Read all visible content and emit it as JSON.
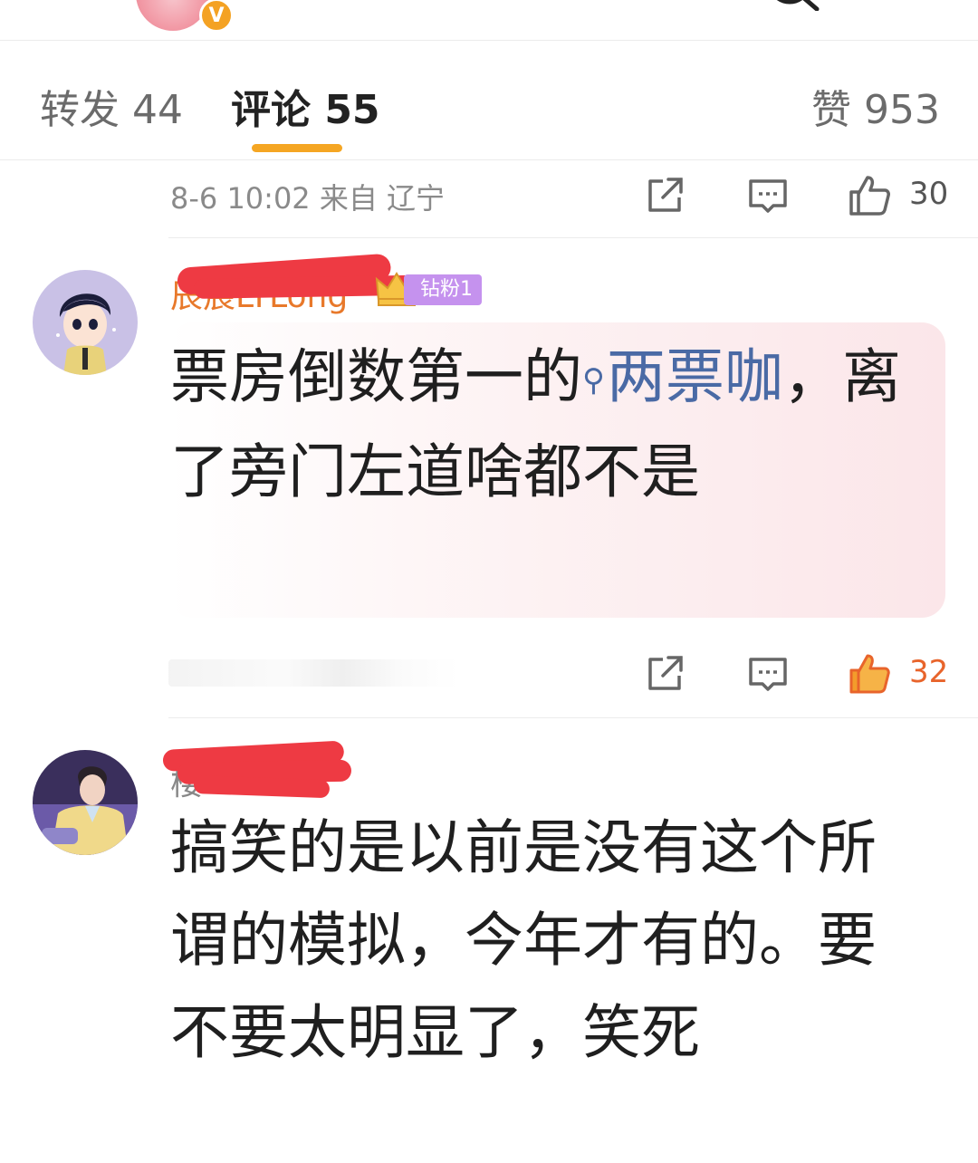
{
  "header": {
    "vip_badge": "V"
  },
  "tabs": {
    "repost": "转发 44",
    "comment": "评论 55",
    "like": "赞 953"
  },
  "comments": [
    {
      "meta": "8-6 10:02 来自 辽宁",
      "like_count": "30",
      "liked": false
    },
    {
      "username": "辰宸LTLong",
      "fan_badge": "钻粉1",
      "text_before_link": "票房倒数第一的",
      "topic_icon": "search-icon",
      "topic_link": "两票咖",
      "text_after_link": "，离了旁门左道啥都不是",
      "like_count": "32",
      "liked": true
    },
    {
      "username": "楼",
      "text": "搞笑的是以前是没有这个所谓的模拟，今年才有的。要不要太明显了，笑死"
    }
  ],
  "colors": {
    "accent_orange": "#f5a623",
    "liked": "#e8642b",
    "username": "#e8792b",
    "link": "#4a6aa5",
    "fan_badge": "#c592ee",
    "redaction": "#ee3a43"
  }
}
